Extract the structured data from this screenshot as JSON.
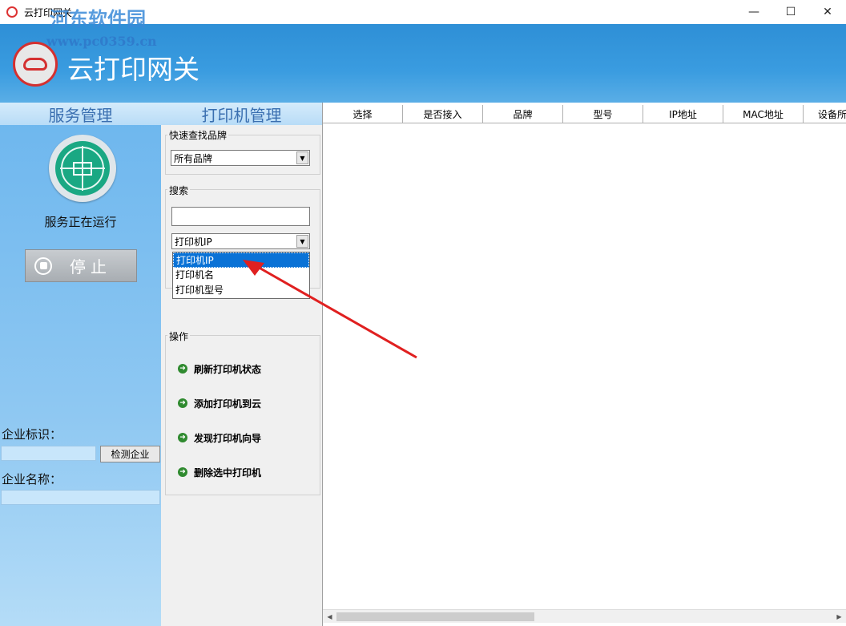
{
  "window": {
    "title": "云打印网关",
    "controls": {
      "minimize": "—",
      "maximize": "☐",
      "close": "✕"
    }
  },
  "watermark": {
    "text": "河东软件园",
    "url": "www.pc0359.cn"
  },
  "banner": {
    "title": "云打印网关"
  },
  "tabs": {
    "service": "服务管理",
    "printer": "打印机管理"
  },
  "service": {
    "status_text": "服务正在运行",
    "stop_label": "停止",
    "enterprise_id_label": "企业标识：",
    "enterprise_id_value": "",
    "detect_button": "检测企业",
    "enterprise_name_label": "企业名称：",
    "enterprise_name_value": ""
  },
  "printer_panel": {
    "brand_group_title": "快速查找品牌",
    "brand_select_value": "所有品牌",
    "search_group_title": "搜索",
    "search_input_value": "",
    "search_type_value": "打印机IP",
    "search_type_options": [
      "打印机IP",
      "打印机名",
      "打印机型号"
    ],
    "ops_group_title": "操作",
    "operations": [
      "刷新打印机状态",
      "添加打印机到云",
      "发现打印机向导",
      "删除选中打印机"
    ]
  },
  "table": {
    "columns": [
      "选择",
      "是否接入",
      "品牌",
      "型号",
      "IP地址",
      "MAC地址",
      "设备所"
    ],
    "rows": []
  },
  "colors": {
    "banner": "#3a9ce0",
    "selection": "#0a72d6",
    "annotation": "#e02020"
  },
  "icons": {
    "logo": "cloud-logo-icon",
    "status": "monitor-target-icon",
    "stop": "stop-icon",
    "operation": "arrow-right-circle-icon"
  }
}
